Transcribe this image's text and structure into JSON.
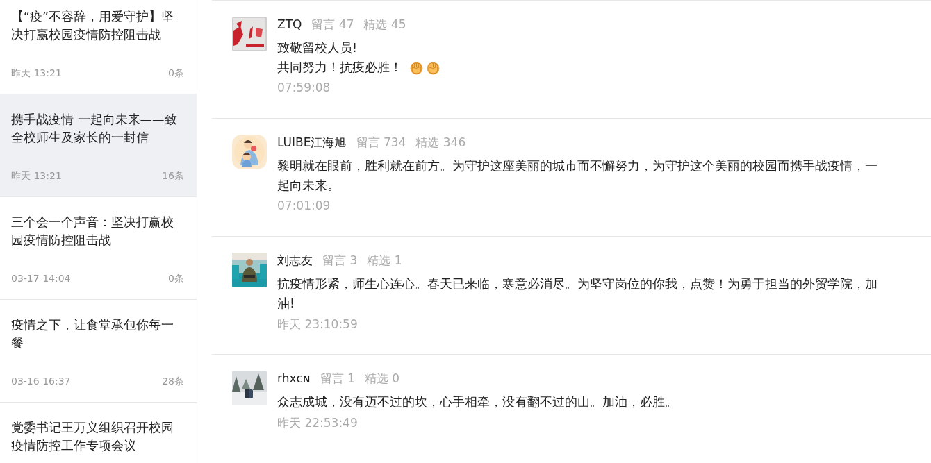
{
  "sidebar": {
    "articles": [
      {
        "title": "【“疫”不容辞，用爱守护】坚决打赢校园疫情防控阻击战",
        "date": "昨天 13:21",
        "count": "0条",
        "selected": false
      },
      {
        "title": "携手战疫情 一起向未来——致全校师生及家长的一封信",
        "date": "昨天 13:21",
        "count": "16条",
        "selected": true
      },
      {
        "title": "三个会一个声音：坚决打赢校园疫情防控阻击战",
        "date": "03-17 14:04",
        "count": "0条",
        "selected": false
      },
      {
        "title": "疫情之下，让食堂承包你每一餐",
        "date": "03-16 16:37",
        "count": "28条",
        "selected": false
      },
      {
        "title": "党委书记王万义组织召开校园疫情防控工作专项会议",
        "selected": false
      }
    ]
  },
  "comments": [
    {
      "name": "ZTQ",
      "replies": "留言 47",
      "picks": "精选 45",
      "paragraphs": [
        "致敬留校人员!",
        "共同努力！抗疫必胜！"
      ],
      "time": "07:59:08"
    },
    {
      "name": "LUIBE江海旭",
      "replies": "留言 734",
      "picks": "精选 346",
      "paragraphs": [
        "黎明就在眼前，胜利就在前方。为守护这座美丽的城市而不懈努力，为守护这个美丽的校园而携手战疫情，一起向未来。"
      ],
      "time": "07:01:09"
    },
    {
      "name": "刘志友",
      "replies": "留言 3",
      "picks": "精选 1",
      "paragraphs": [
        "抗疫情形紧，师生心连心。春天已来临，寒意必消尽。为坚守岗位的你我，点赞！为勇于担当的外贸学院，加油!"
      ],
      "time": "昨天 23:10:59"
    },
    {
      "name": "rhxᴄɴ",
      "replies": "留言 1",
      "picks": "精选 0",
      "paragraphs": [
        "众志成城，没有迈不过的坎，心手相牵，没有翻不过的山。加油，必胜。"
      ],
      "time": "昨天 22:53:49"
    }
  ]
}
